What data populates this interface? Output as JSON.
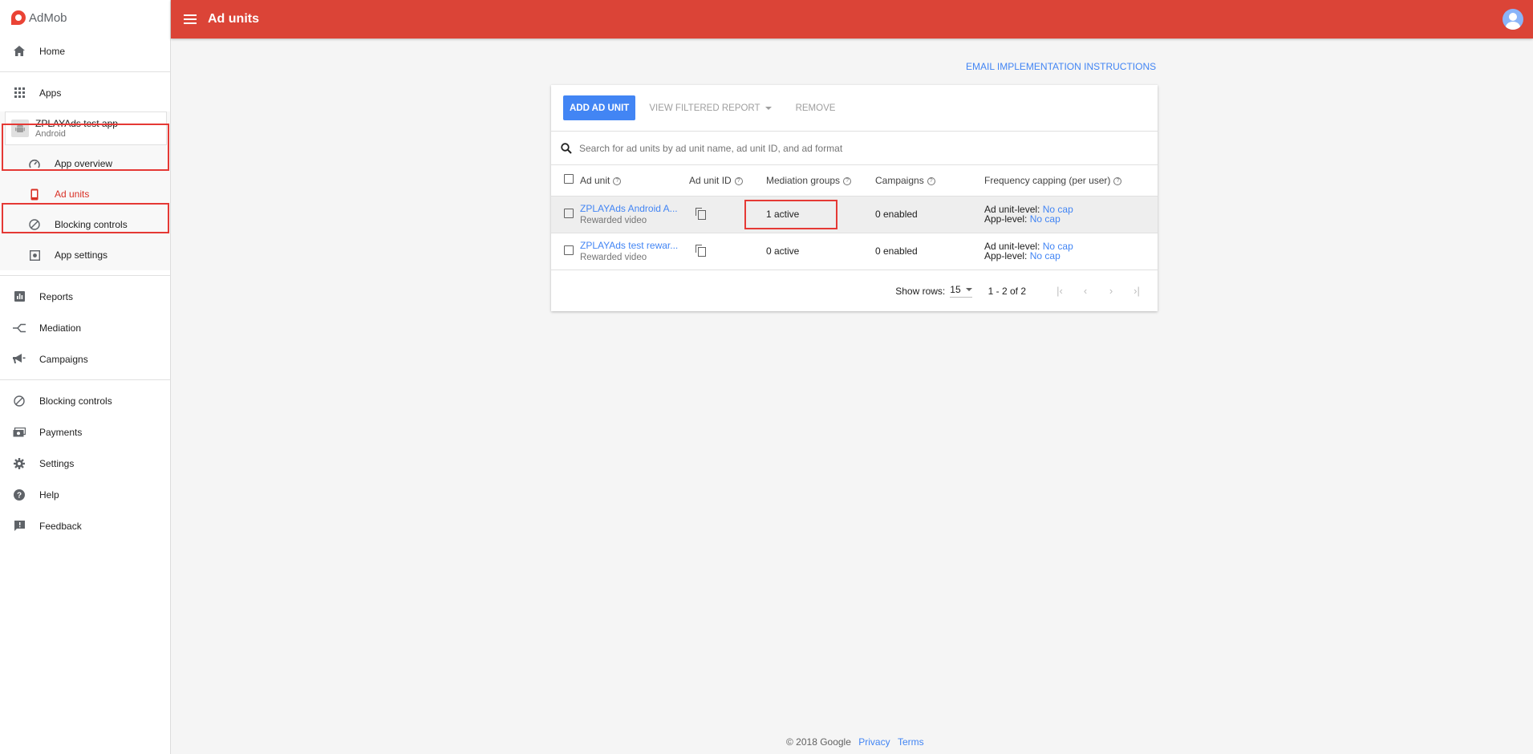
{
  "brand": {
    "name": "AdMob"
  },
  "header": {
    "title": "Ad units"
  },
  "sidebar": {
    "items_top": [
      {
        "label": "Home",
        "icon": "home-icon"
      },
      {
        "label": "Apps",
        "icon": "apps-grid-icon"
      }
    ],
    "app": {
      "name": "ZPLAYAds test app",
      "platform": "Android"
    },
    "app_subitems": [
      {
        "label": "App overview",
        "icon": "speedometer-icon"
      },
      {
        "label": "Ad units",
        "icon": "phone-icon",
        "active": true
      },
      {
        "label": "Blocking controls",
        "icon": "block-icon"
      },
      {
        "label": "App settings",
        "icon": "settings-box-icon"
      }
    ],
    "items_mid": [
      {
        "label": "Reports",
        "icon": "bar-chart-icon"
      },
      {
        "label": "Mediation",
        "icon": "mediation-icon"
      },
      {
        "label": "Campaigns",
        "icon": "megaphone-icon"
      }
    ],
    "items_bottom": [
      {
        "label": "Blocking controls",
        "icon": "block-icon"
      },
      {
        "label": "Payments",
        "icon": "payments-icon"
      },
      {
        "label": "Settings",
        "icon": "gear-icon"
      },
      {
        "label": "Help",
        "icon": "help-icon"
      },
      {
        "label": "Feedback",
        "icon": "feedback-icon"
      }
    ]
  },
  "main": {
    "email_link": "EMAIL IMPLEMENTATION INSTRUCTIONS",
    "toolbar": {
      "add_label": "ADD AD UNIT",
      "report_label": "VIEW FILTERED REPORT",
      "remove_label": "REMOVE"
    },
    "search": {
      "placeholder": "Search for ad units by ad unit name, ad unit ID, and ad format"
    },
    "table": {
      "columns": [
        "Ad unit",
        "Ad unit ID",
        "Mediation groups",
        "Campaigns",
        "Frequency capping (per user)"
      ],
      "rows": [
        {
          "name": "ZPLAYAds Android A...",
          "format": "Rewarded video",
          "mediation": "1 active",
          "campaigns": "0 enabled",
          "unit_level_label": "Ad unit-level:",
          "unit_level_value": "No cap",
          "app_level_label": "App-level:",
          "app_level_value": "No cap"
        },
        {
          "name": "ZPLAYAds test rewar...",
          "format": "Rewarded video",
          "mediation": "0 active",
          "campaigns": "0 enabled",
          "unit_level_label": "Ad unit-level:",
          "unit_level_value": "No cap",
          "app_level_label": "App-level:",
          "app_level_value": "No cap"
        }
      ]
    },
    "pagination": {
      "show_rows_label": "Show rows:",
      "rows_value": "15",
      "range": "1 - 2 of 2"
    }
  },
  "footer": {
    "copyright": "© 2018 Google",
    "privacy": "Privacy",
    "terms": "Terms"
  },
  "colors": {
    "topbar": "#db4437",
    "accent": "#4285f4",
    "highlight": "#e53935"
  }
}
